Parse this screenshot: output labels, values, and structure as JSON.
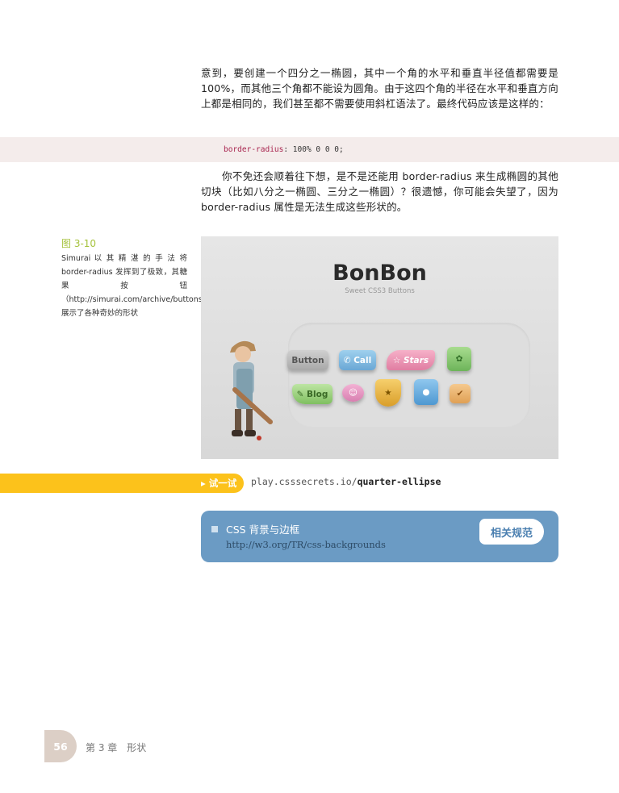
{
  "body": {
    "paragraph1": "意到，要创建一个四分之一椭圆，其中一个角的水平和垂直半径值都需要是100%，而其他三个角都不能设为圆角。由于这四个角的半径在水平和垂直方向上都是相同的，我们甚至都不需要使用斜杠语法了。最终代码应该是这样的：",
    "code_property": "border-radius",
    "code_value": ": 100% 0 0 0;",
    "paragraph2": "你不免还会顺着往下想，是不是还能用 border-radius 来生成椭圆的其他切块（比如八分之一椭圆、三分之一椭圆）？很遗憾，你可能会失望了，因为 border-radius 属性是无法生成这些形状的。"
  },
  "figure": {
    "label": "图 3-10",
    "caption": "Simurai 以 其 精 湛 的 手 法 将 border-radius 发挥到了极致，其糖果按钮（http://simurai.com/archive/buttons）展示了各种奇妙的形状",
    "brand_title": "BonBon",
    "brand_subtitle": "Sweet CSS3 Buttons",
    "buttons": {
      "button": "Button",
      "call": "✆ Call",
      "stars": "☆ Stars",
      "flower": "✿",
      "blog": "✎ Blog",
      "smile": "☺",
      "star": "★",
      "apple": "●",
      "check": "✔"
    }
  },
  "try_it": {
    "label": "▸ 试一试",
    "url_prefix": "play.csssecrets.io/",
    "url_path": "quarter-ellipse"
  },
  "spec": {
    "title": "CSS 背景与边框",
    "url": "http://w3.org/TR/css-backgrounds",
    "tag": "相关规范"
  },
  "footer": {
    "page_number": "56",
    "chapter": "第 3 章　形状"
  },
  "colors": {
    "accent_green": "#a5c23c",
    "ribbon_yellow": "#fcc21b",
    "spec_blue": "#6b9bc4",
    "code_bg": "#f4eceb"
  }
}
